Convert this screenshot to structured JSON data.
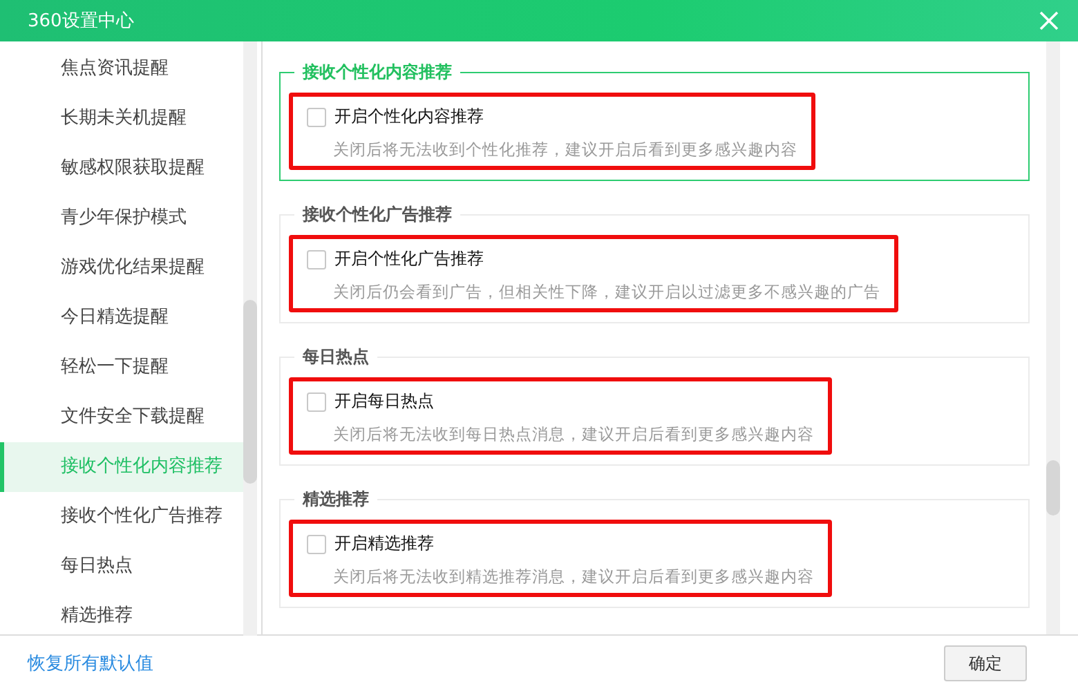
{
  "window": {
    "title": "360设置中心"
  },
  "sidebar": {
    "items": [
      {
        "label": "焦点资讯提醒",
        "selected": false
      },
      {
        "label": "长期未关机提醒",
        "selected": false
      },
      {
        "label": "敏感权限获取提醒",
        "selected": false
      },
      {
        "label": "青少年保护模式",
        "selected": false
      },
      {
        "label": "游戏优化结果提醒",
        "selected": false
      },
      {
        "label": "今日精选提醒",
        "selected": false
      },
      {
        "label": "轻松一下提醒",
        "selected": false
      },
      {
        "label": "文件安全下载提醒",
        "selected": false
      },
      {
        "label": "接收个性化内容推荐",
        "selected": true
      },
      {
        "label": "接收个性化广告推荐",
        "selected": false
      },
      {
        "label": "每日热点",
        "selected": false
      },
      {
        "label": "精选推荐",
        "selected": false
      }
    ]
  },
  "sections": [
    {
      "title": "接收个性化内容推荐",
      "selected": true,
      "highlighted": true,
      "option": {
        "label": "开启个性化内容推荐",
        "checked": false,
        "description": "关闭后将无法收到个性化推荐，建议开启后看到更多感兴趣内容"
      }
    },
    {
      "title": "接收个性化广告推荐",
      "selected": false,
      "highlighted": true,
      "option": {
        "label": "开启个性化广告推荐",
        "checked": false,
        "description": "关闭后仍会看到广告，但相关性下降，建议开启以过滤更多不感兴趣的广告"
      }
    },
    {
      "title": "每日热点",
      "selected": false,
      "highlighted": true,
      "option": {
        "label": "开启每日热点",
        "checked": false,
        "description": "关闭后将无法收到每日热点消息，建议开启后看到更多感兴趣内容"
      }
    },
    {
      "title": "精选推荐",
      "selected": false,
      "highlighted": true,
      "option": {
        "label": "开启精选推荐",
        "checked": false,
        "description": "关闭后将无法收到精选推荐消息，建议开启后看到更多感兴趣内容"
      }
    }
  ],
  "footer": {
    "reset_link": "恢复所有默认值",
    "confirm_button": "确定"
  }
}
